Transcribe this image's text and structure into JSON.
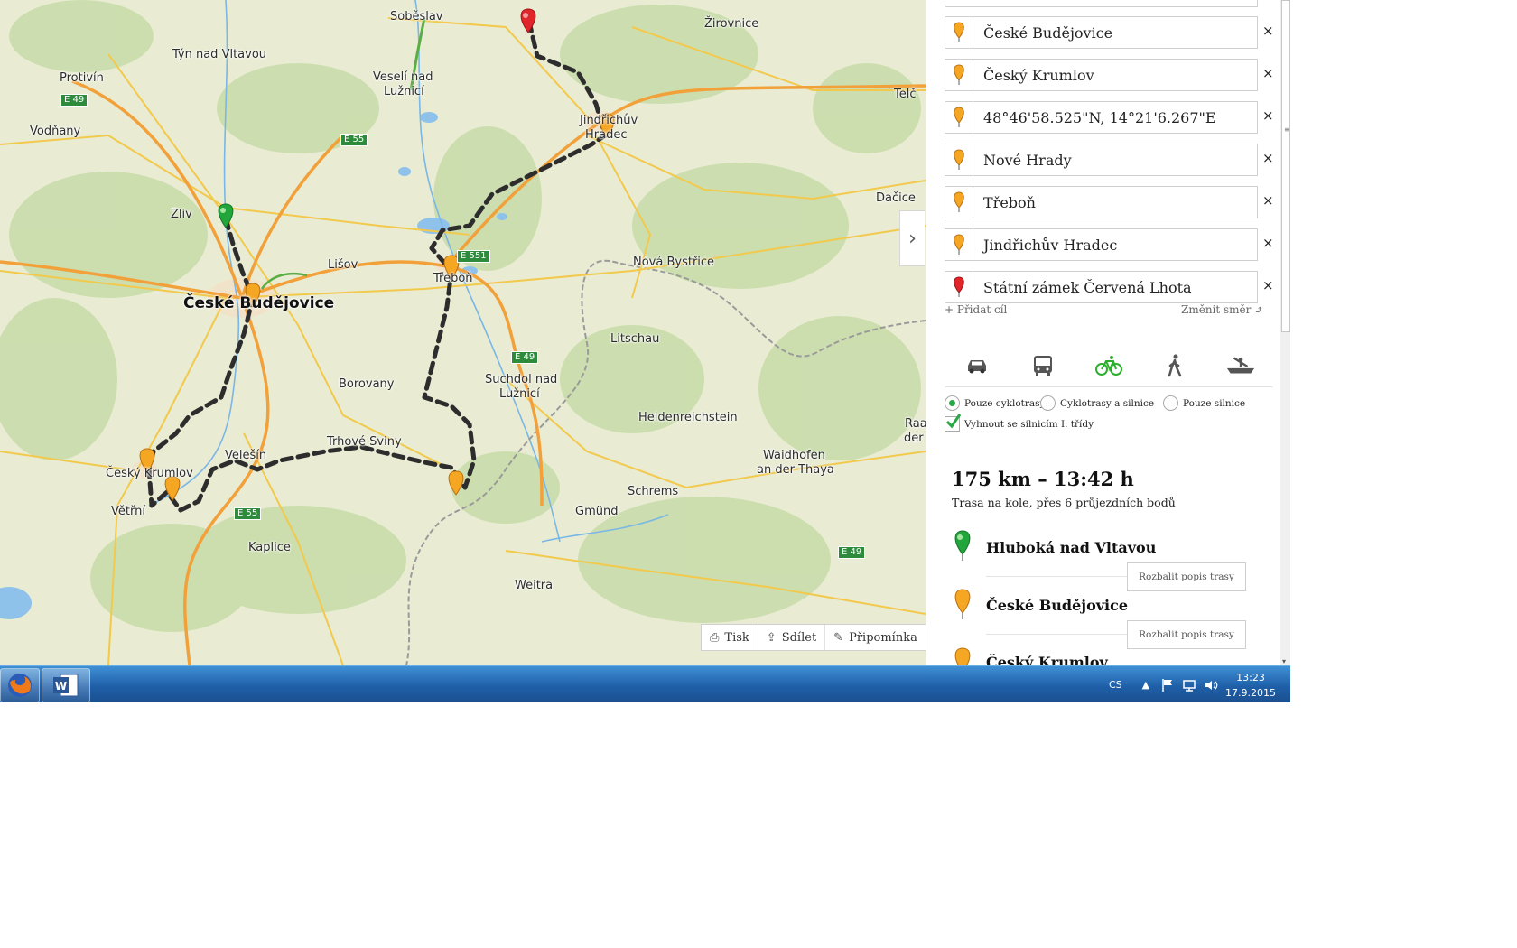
{
  "map": {
    "towns": [
      {
        "name": "Soběslav"
      },
      {
        "name": "Týn nad Vltavou"
      },
      {
        "name": "Protivín"
      },
      {
        "name": "Veselí nad"
      },
      {
        "name": "Lužnicí"
      },
      {
        "name": "Žirovnice"
      },
      {
        "name": "Jindřichův"
      },
      {
        "name": "Hradec"
      },
      {
        "name": "Telč"
      },
      {
        "name": "Vodňany"
      },
      {
        "name": "Zliv"
      },
      {
        "name": "Dačice"
      },
      {
        "name": "Lišov"
      },
      {
        "name": "Třeboň"
      },
      {
        "name": "Nová Bystřice"
      },
      {
        "name": "České Budějovice",
        "big": true
      },
      {
        "name": "Litschau"
      },
      {
        "name": "Suchdol nad"
      },
      {
        "name": "Lužnicí"
      },
      {
        "name": "Borovany"
      },
      {
        "name": "Heidenreichstein"
      },
      {
        "name": "Raal"
      },
      {
        "name": "der T"
      },
      {
        "name": "Trhové Sviny"
      },
      {
        "name": "Velešín"
      },
      {
        "name": "Waidhofen"
      },
      {
        "name": "an der Thaya"
      },
      {
        "name": "Český Krumlov"
      },
      {
        "name": "Schrems"
      },
      {
        "name": "Větřní"
      },
      {
        "name": "Gmünd"
      },
      {
        "name": "Kaplice"
      },
      {
        "name": "Weitra"
      }
    ],
    "road_signs": [
      "E 49",
      "E 55",
      "E 551",
      "E 49",
      "E 55",
      "E 49"
    ],
    "tools": [
      {
        "icon": "printer-icon",
        "glyph": "⎙",
        "label": "Tisk"
      },
      {
        "icon": "share-icon",
        "glyph": "⇪",
        "label": "Sdílet"
      },
      {
        "icon": "pencil-icon",
        "glyph": "✎",
        "label": "Připomínka"
      }
    ],
    "collapse_glyph": "›",
    "colors": {
      "route": "#2d2d2d",
      "forest": "#c8dcaa",
      "water": "#7ab6e6",
      "road_yellow": "#f3d354",
      "road_orange": "#f2a13a",
      "border": "#9a9a9a"
    }
  },
  "panel": {
    "waypoints": [
      {
        "value": "České Budějovice",
        "pin": "orange"
      },
      {
        "value": "Český Krumlov",
        "pin": "orange"
      },
      {
        "value": "48°46'58.525\"N, 14°21'6.267\"E",
        "pin": "orange"
      },
      {
        "value": "Nové Hrady",
        "pin": "orange"
      },
      {
        "value": "Třeboň",
        "pin": "orange"
      },
      {
        "value": "Jindřichův Hradec",
        "pin": "orange"
      },
      {
        "value": "Státní zámek Červená Lhota",
        "pin": "red"
      }
    ],
    "remove_glyph": "×",
    "add_target": "+ Přidat cíl",
    "change_direction": "Změnit směr ⤴",
    "modes": [
      "car-icon",
      "bus-icon",
      "bicycle-icon",
      "walking-icon",
      "boat-icon"
    ],
    "active_mode": "bicycle-icon",
    "options": {
      "radio": [
        "Pouze cyklotrasy",
        "Cyklotrasy a silnice",
        "Pouze silnice"
      ],
      "selected": "Pouze cyklotrasy",
      "checkbox": "Vyhnout se silnicím I. třídy",
      "checkbox_checked": true
    },
    "summary": {
      "distance_time": "175 km – 13:42 h",
      "description": "Trasa na kole, přes 6 průjezdních bodů"
    },
    "stops": [
      {
        "name": "Hluboká nad Vltavou",
        "pin": "green"
      },
      {
        "name": "České Budějovice",
        "pin": "orange"
      },
      {
        "name": "Český Krumlov",
        "pin": "orange"
      }
    ],
    "expand_label": "Rozbalit popis trasy"
  },
  "taskbar": {
    "apps": [
      "firefox-icon",
      "word-icon"
    ],
    "language": "CS",
    "time": "13:23",
    "date": "17.9.2015"
  }
}
